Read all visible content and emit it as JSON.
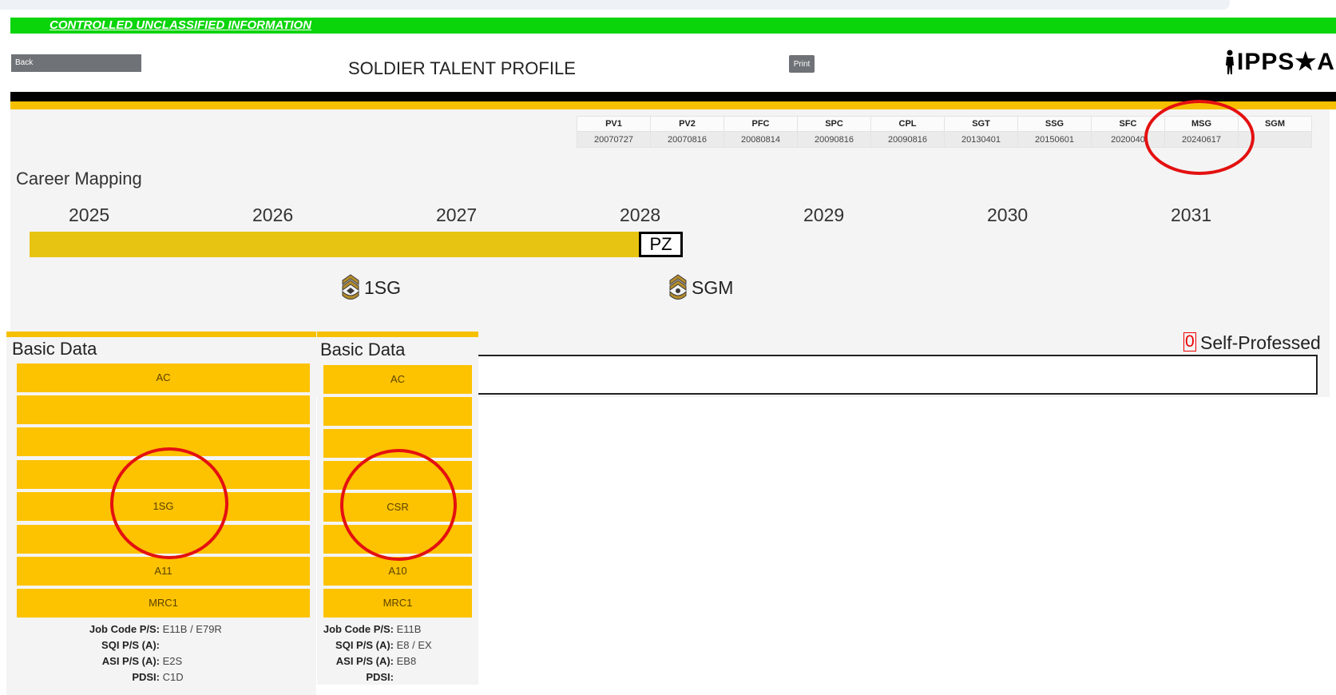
{
  "banner": {
    "cui": "CONTROLLED UNCLASSIFIED INFORMATION"
  },
  "header": {
    "back": "Back",
    "title": "SOLDIER TALENT PROFILE",
    "print": "Print",
    "logo": "IPPS★A"
  },
  "ranks": {
    "headers": [
      "PV1",
      "PV2",
      "PFC",
      "SPC",
      "CPL",
      "SGT",
      "SSG",
      "SFC",
      "MSG",
      "SGM"
    ],
    "dates": [
      "20070727",
      "20070816",
      "20080814",
      "20090816",
      "20090816",
      "20130401",
      "20150601",
      "2020040",
      "20240617",
      ""
    ]
  },
  "career": {
    "title": "Career Mapping",
    "years": [
      "2025",
      "2026",
      "2027",
      "2028",
      "2029",
      "2030",
      "2031"
    ],
    "pz": "PZ",
    "milestones": [
      "1SG",
      "SGM"
    ]
  },
  "self_professed": {
    "count": "0",
    "label": "Self-Professed"
  },
  "card1": {
    "title": "Basic Data",
    "rows": [
      "AC",
      "",
      "",
      "",
      "1SG",
      "",
      "A11",
      "MRC1"
    ],
    "info": [
      {
        "k": "Job Code P/S:",
        "v": "E11B / E79R"
      },
      {
        "k": "SQI P/S (A):",
        "v": ""
      },
      {
        "k": "ASI P/S (A):",
        "v": "E2S"
      },
      {
        "k": "PDSI:",
        "v": "C1D"
      }
    ]
  },
  "card2": {
    "title": "Basic Data",
    "rows": [
      "AC",
      "",
      "",
      "",
      "CSR",
      "",
      "A10",
      "MRC1"
    ],
    "info": [
      {
        "k": "Job Code P/S:",
        "v": "E11B"
      },
      {
        "k": "SQI P/S (A):",
        "v": "E8 / EX"
      },
      {
        "k": "ASI P/S (A):",
        "v": "EB8"
      },
      {
        "k": "PDSI:",
        "v": ""
      }
    ]
  },
  "colors": {
    "cui_green": "#0ad40a",
    "gold": "#f6c000",
    "row_yellow": "#fdc200",
    "timeline": "#e8c412",
    "annotation_red": "#e41010"
  }
}
